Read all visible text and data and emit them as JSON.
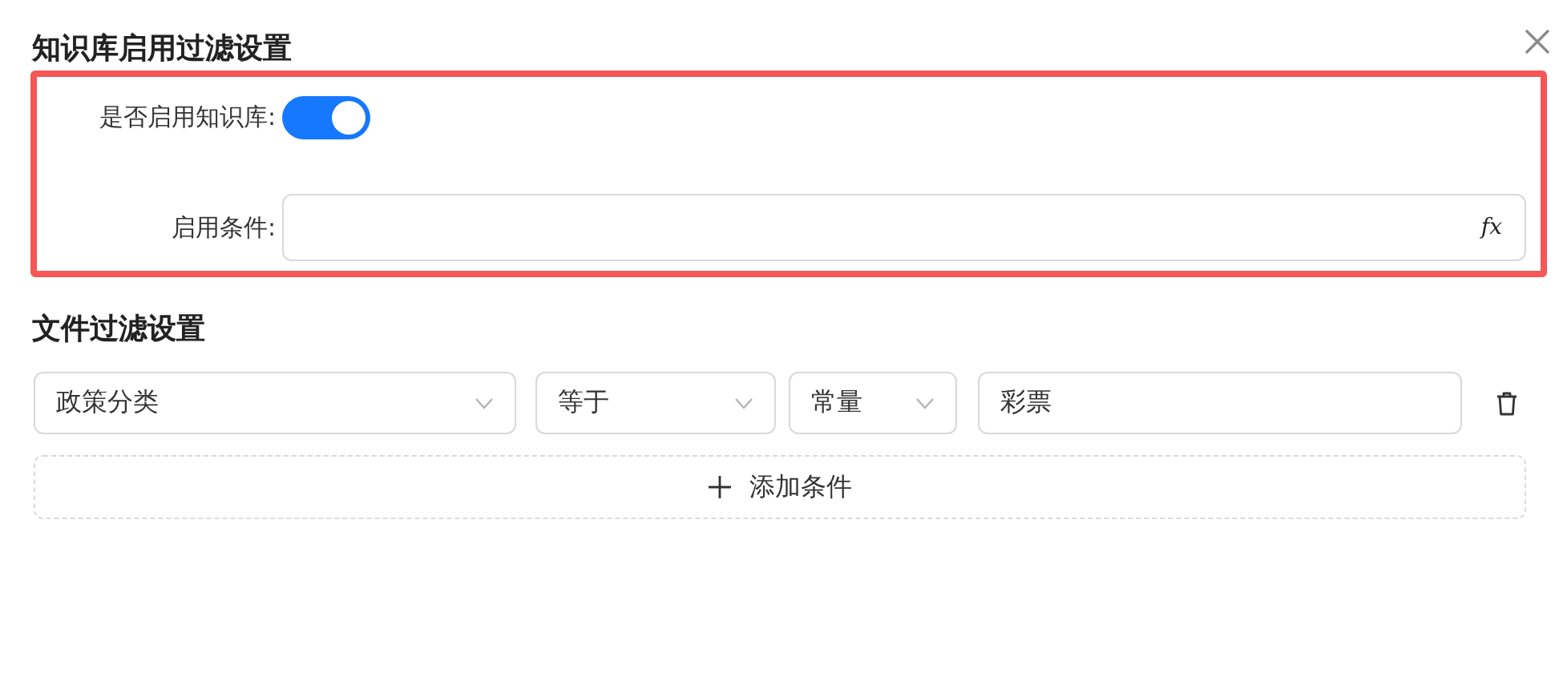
{
  "dialog": {
    "title": "知识库启用过滤设置"
  },
  "knowledge": {
    "highlighted": true,
    "enable_label": "是否启用知识库:",
    "enabled": true,
    "condition_label": "启用条件:",
    "formula_button": "fx"
  },
  "file_filter": {
    "title": "文件过滤设置",
    "conditions": [
      {
        "fields": [
          {
            "kind": "select",
            "value": "政策分类"
          },
          {
            "kind": "select",
            "value": "等于"
          },
          {
            "kind": "select",
            "value": "常量"
          },
          {
            "kind": "input",
            "value": "彩票"
          }
        ]
      }
    ],
    "add_button": "添加条件"
  }
}
